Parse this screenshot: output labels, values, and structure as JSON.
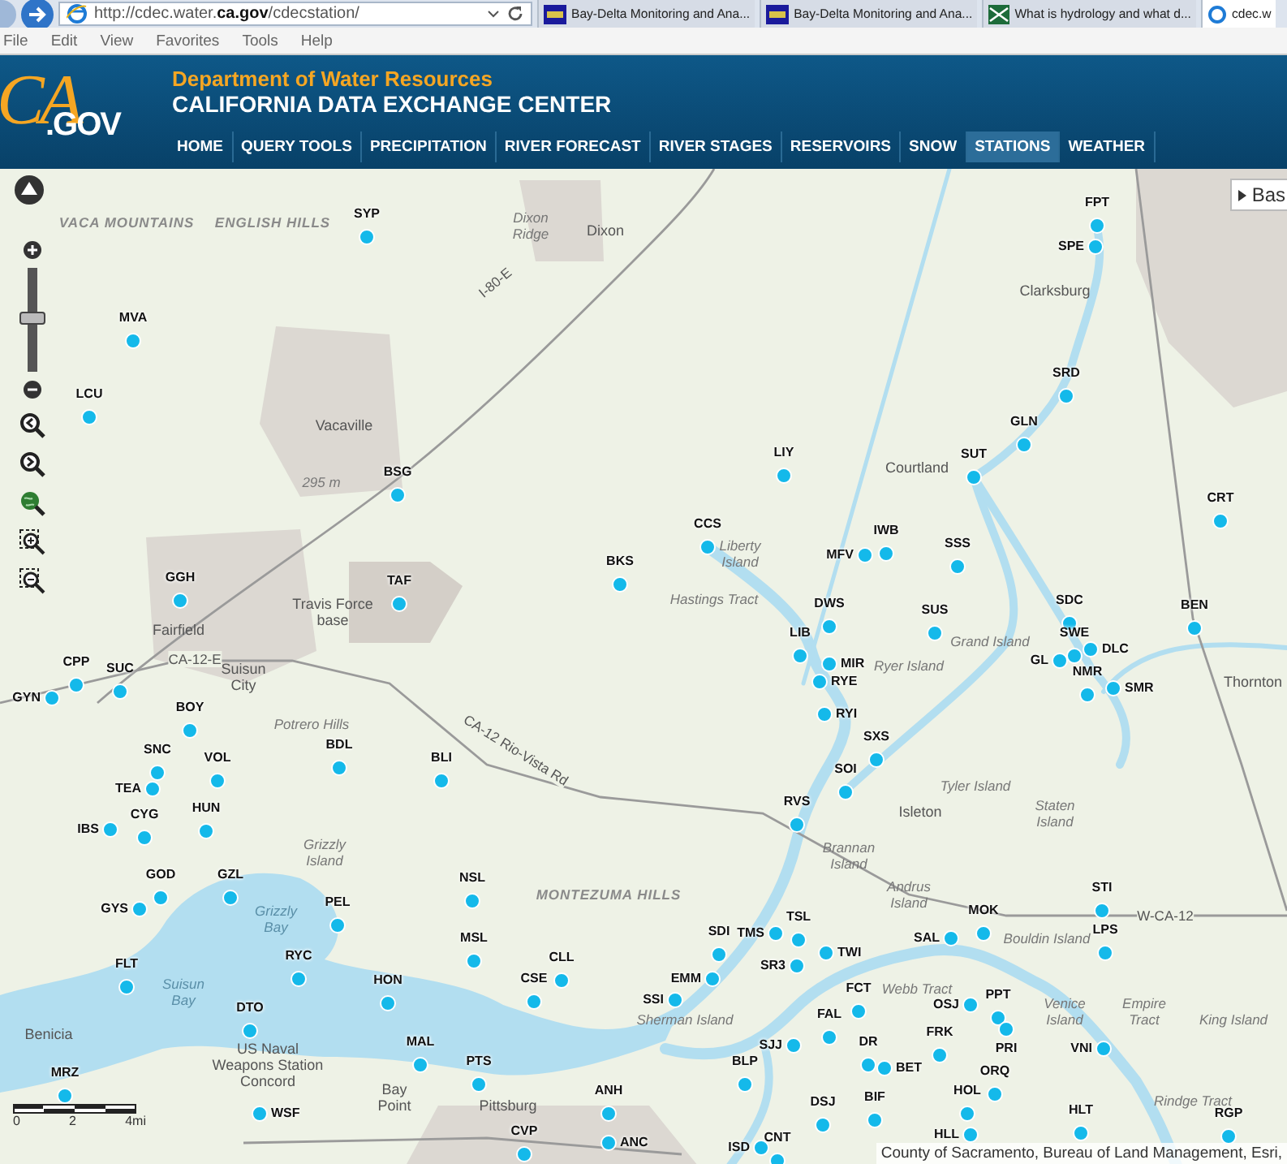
{
  "browser": {
    "address": "http://cdec.water.**ca.gov**/cdecstation/",
    "tabs": [
      {
        "label": "Bay-Delta Monitoring and Ana...",
        "selected": false
      },
      {
        "label": "Bay-Delta Monitoring and Ana...",
        "selected": false
      },
      {
        "label": "What is hydrology and what d...",
        "selected": false
      },
      {
        "label": "cdec.w",
        "selected": true
      }
    ],
    "menu": [
      "File",
      "Edit",
      "View",
      "Favorites",
      "Tools",
      "Help"
    ]
  },
  "header": {
    "logo": "CA",
    "logo_suffix": ".GOV",
    "department": "Department of Water Resources",
    "title": "CALIFORNIA DATA EXCHANGE CENTER",
    "nav": [
      {
        "label": "HOME",
        "selected": false
      },
      {
        "label": "QUERY TOOLS",
        "selected": false
      },
      {
        "label": "PRECIPITATION",
        "selected": false
      },
      {
        "label": "RIVER FORECAST",
        "selected": false
      },
      {
        "label": "RIVER STAGES",
        "selected": false
      },
      {
        "label": "RESERVOIRS",
        "selected": false
      },
      {
        "label": "SNOW",
        "selected": false
      },
      {
        "label": "STATIONS",
        "selected": true
      },
      {
        "label": "WEATHER",
        "selected": false
      }
    ]
  },
  "map": {
    "zoom": {
      "level": 0.5
    },
    "basemap_button": "Bas",
    "stations": [
      "SYP",
      "MVA",
      "LCU",
      "BSG",
      "GGH",
      "TAF",
      "BKS",
      "FPT",
      "SPE",
      "SRD",
      "GLN",
      "SUT",
      "CRT",
      "LIY",
      "CCS",
      "MFV",
      "IWB",
      "SSS",
      "DWS",
      "SDC",
      "BEN",
      "SUS",
      "DLC",
      "SWE",
      "GL",
      "LIB",
      "MIR",
      "RYE",
      "RYI",
      "SXS",
      "SOI",
      "RVS",
      "NMR",
      "SMR",
      "CPP",
      "GYN",
      "SUC",
      "BOY",
      "SNC",
      "TEA",
      "VOL",
      "BDL",
      "BLI",
      "IBS",
      "CYG",
      "HUN",
      "GOD",
      "GYS",
      "GZL",
      "PEL",
      "NSL",
      "MSL",
      "CLL",
      "CSE",
      "RYC",
      "HON",
      "FLT",
      "DTO",
      "MAL",
      "PTS",
      "MRZ",
      "WSF",
      "ANH",
      "ANC",
      "CVP",
      "TMS",
      "TSL",
      "SR3",
      "TWI",
      "SDI",
      "EMM",
      "SSI",
      "SAL",
      "MOK",
      "STI",
      "LPS",
      "OSJ",
      "PPT",
      "PRI",
      "FCT",
      "FAL",
      "SJJ",
      "DR",
      "BET",
      "FRK",
      "VNI",
      "BLP",
      "ORQ",
      "HOL",
      "HLL",
      "BIF",
      "DSJ",
      "ISD",
      "CNT",
      "HLT",
      "RGP"
    ],
    "places": [
      {
        "text": "VACA MOUNTAINS",
        "kind": "region"
      },
      {
        "text": "ENGLISH HILLS",
        "kind": "region"
      },
      {
        "text": "Dixon Ridge",
        "kind": "area"
      },
      {
        "text": "Dixon",
        "kind": "city"
      },
      {
        "text": "Vacaville",
        "kind": "city"
      },
      {
        "text": "295 m",
        "kind": "area"
      },
      {
        "text": "Fairfield",
        "kind": "city"
      },
      {
        "text": "Travis Force base",
        "kind": "city"
      },
      {
        "text": "Suisun City",
        "kind": "city"
      },
      {
        "text": "Potrero Hills",
        "kind": "area"
      },
      {
        "text": "Grizzly Island",
        "kind": "area"
      },
      {
        "text": "Grizzly Bay",
        "kind": "water"
      },
      {
        "text": "Suisun Bay",
        "kind": "water"
      },
      {
        "text": "Benicia",
        "kind": "city"
      },
      {
        "text": "US Naval Weapons Station Concord",
        "kind": "city"
      },
      {
        "text": "Bay Point",
        "kind": "city"
      },
      {
        "text": "Pittsburg",
        "kind": "city"
      },
      {
        "text": "MONTEZUMA HILLS",
        "kind": "region"
      },
      {
        "text": "Liberty Island",
        "kind": "area"
      },
      {
        "text": "Hastings Tract",
        "kind": "area"
      },
      {
        "text": "Clarksburg",
        "kind": "city"
      },
      {
        "text": "Courtland",
        "kind": "city"
      },
      {
        "text": "Grand Island",
        "kind": "area"
      },
      {
        "text": "Ryer Island",
        "kind": "area"
      },
      {
        "text": "Tyler Island",
        "kind": "area"
      },
      {
        "text": "Isleton",
        "kind": "city"
      },
      {
        "text": "Staten Island",
        "kind": "area"
      },
      {
        "text": "Brannan Island",
        "kind": "area"
      },
      {
        "text": "Andrus Island",
        "kind": "area"
      },
      {
        "text": "Bouldin Island",
        "kind": "area"
      },
      {
        "text": "Webb Tract",
        "kind": "area"
      },
      {
        "text": "Sherman Island",
        "kind": "area"
      },
      {
        "text": "Venice Island",
        "kind": "area"
      },
      {
        "text": "Empire Tract",
        "kind": "area"
      },
      {
        "text": "King Island",
        "kind": "area"
      },
      {
        "text": "Rindge Tract",
        "kind": "area"
      },
      {
        "text": "Thornton",
        "kind": "city"
      },
      {
        "text": "CA-12-E",
        "kind": "road"
      },
      {
        "text": "W-CA-12",
        "kind": "road"
      },
      {
        "text": "I-80-E",
        "kind": "road"
      },
      {
        "text": "CA-12 Rio-Vista Rd",
        "kind": "road"
      }
    ],
    "scale": [
      "0",
      "2",
      "4mi"
    ],
    "attribution": "County of Sacramento, Bureau of Land Management, Esri,"
  }
}
